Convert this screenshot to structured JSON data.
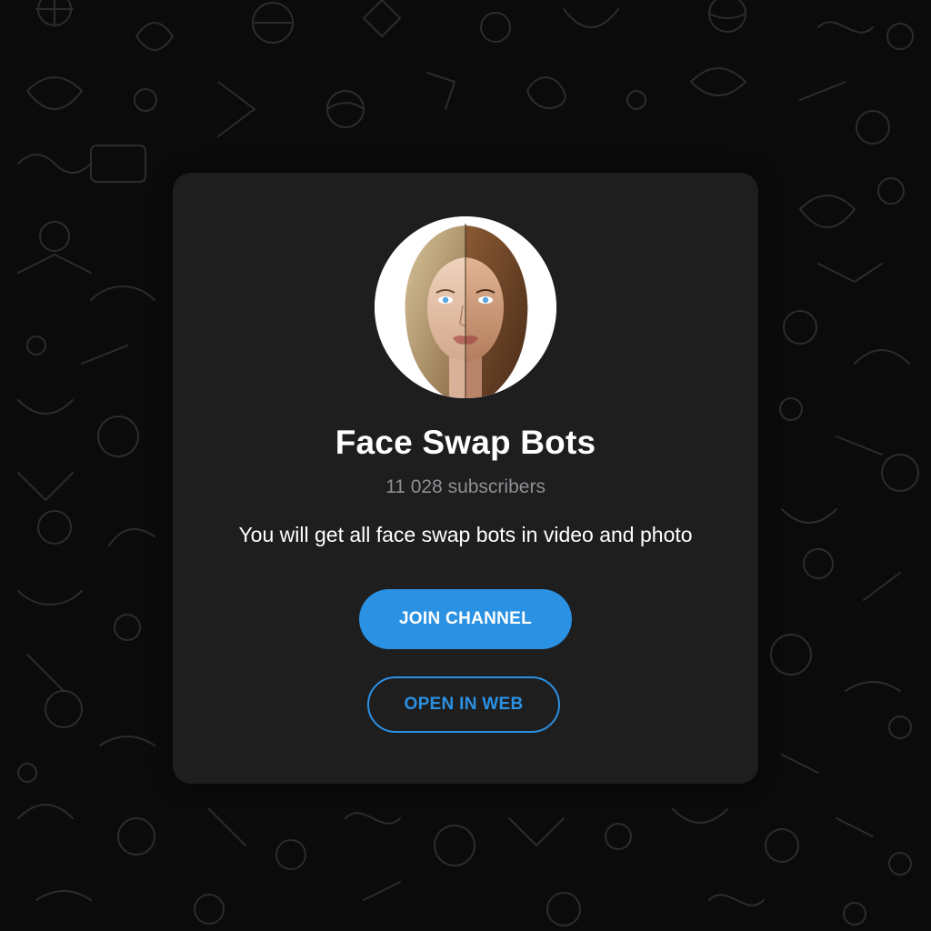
{
  "channel": {
    "name": "Face Swap Bots",
    "subscribers": "11 028 subscribers",
    "description": "You will get all face swap bots in video and photo"
  },
  "actions": {
    "join_label": "JOIN CHANNEL",
    "web_label": "OPEN IN WEB"
  },
  "colors": {
    "accent": "#2b91e3",
    "card_bg": "#1e1e1f",
    "page_bg": "#0b0b0b",
    "muted_text": "#8e8e93"
  },
  "icons": {
    "avatar": "face-swap-avatar",
    "background": "doodle-pattern"
  }
}
